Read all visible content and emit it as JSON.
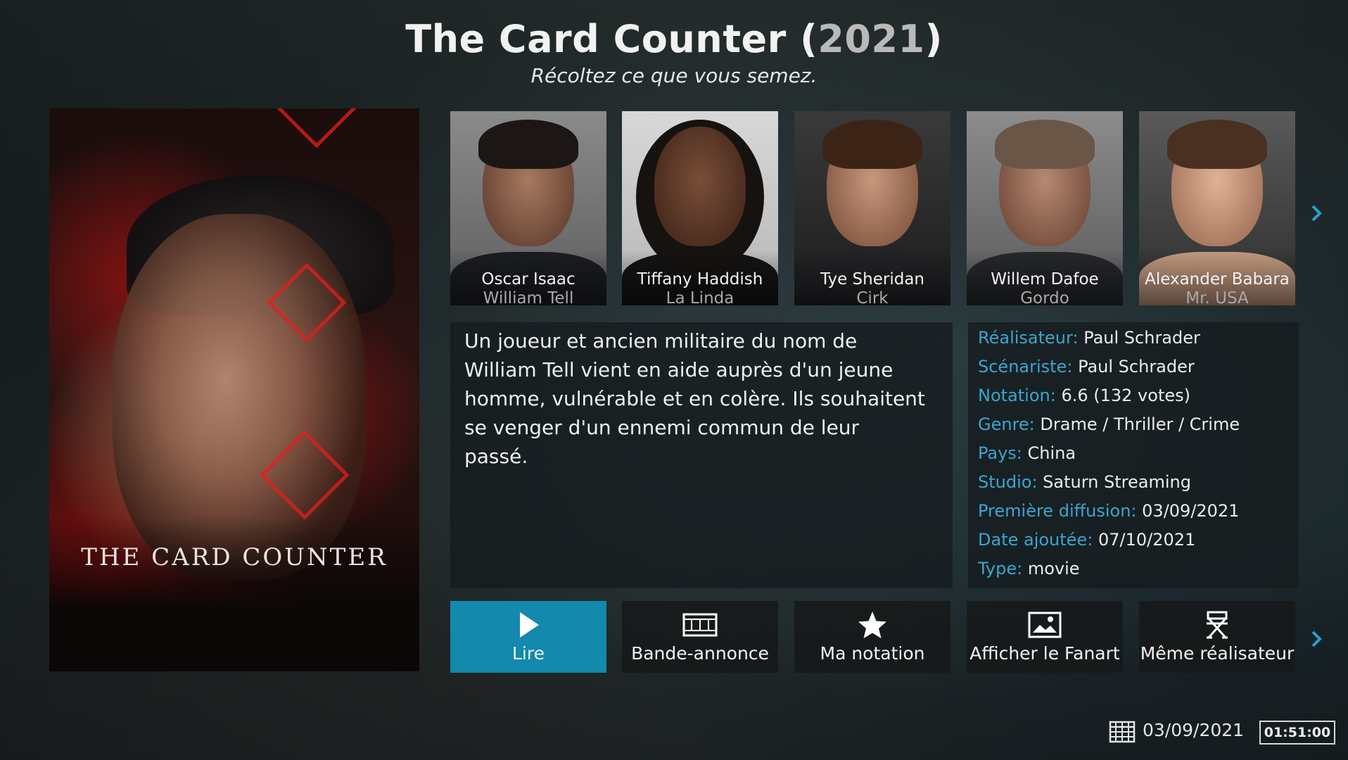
{
  "header": {
    "title": "The Card Counter",
    "year_open": " (",
    "year": "2021",
    "year_close": ")",
    "tagline": "Récoltez ce que vous semez."
  },
  "poster": {
    "title_text": "THE CARD COUNTER"
  },
  "cast": [
    {
      "name": "Oscar Isaac",
      "role": "William Tell"
    },
    {
      "name": "Tiffany Haddish",
      "role": "La Linda"
    },
    {
      "name": "Tye Sheridan",
      "role": "Cirk"
    },
    {
      "name": "Willem Dafoe",
      "role": "Gordo"
    },
    {
      "name": "Alexander Babara",
      "role": "Mr. USA"
    }
  ],
  "plot": "Un joueur et ancien militaire du nom de William Tell vient en aide auprès d'un jeune homme, vulnérable et en colère. Ils souhaitent se venger d'un ennemi commun de leur passé.",
  "info": [
    {
      "key": "Réalisateur:",
      "value": "Paul Schrader"
    },
    {
      "key": "Scénariste:",
      "value": "Paul Schrader"
    },
    {
      "key": "Notation:",
      "value": "6.6 (132 votes)"
    },
    {
      "key": "Genre:",
      "value": "Drame / Thriller / Crime"
    },
    {
      "key": "Pays:",
      "value": "China"
    },
    {
      "key": "Studio:",
      "value": "Saturn Streaming"
    },
    {
      "key": "Première diffusion:",
      "value": "03/09/2021"
    },
    {
      "key": "Date ajoutée:",
      "value": "07/10/2021"
    },
    {
      "key": "Type:",
      "value": "movie"
    }
  ],
  "buttons": [
    {
      "label": "Lire",
      "icon": "play-icon",
      "active": true
    },
    {
      "label": "Bande-annonce",
      "icon": "film-icon",
      "active": false
    },
    {
      "label": "Ma notation",
      "icon": "star-icon",
      "active": false
    },
    {
      "label": "Afficher le Fanart",
      "icon": "image-icon",
      "active": false
    },
    {
      "label": "Même réalisateur",
      "icon": "director-chair-icon",
      "active": false
    }
  ],
  "footer": {
    "date": "03/09/2021",
    "time": "01:51:00"
  },
  "colors": {
    "accent": "#1289ad",
    "label_blue": "#3aa6cf"
  }
}
